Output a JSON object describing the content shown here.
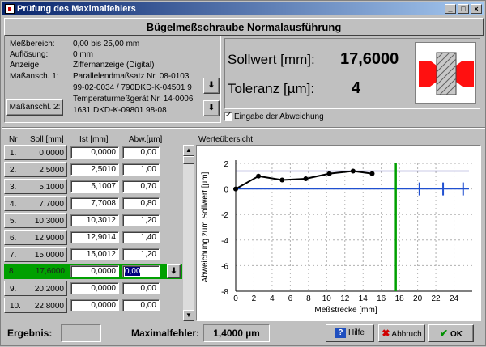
{
  "window": {
    "title": "Prüfung des Maximalfehlers",
    "minimize": "_",
    "maximize": "□",
    "close": "×"
  },
  "header": "Bügelmeßschraube Normalausführung",
  "info": {
    "messbereich_label": "Meßbereich:",
    "messbereich_value": "0,00 bis   25,00 mm",
    "aufloesung_label": "Auflösung:",
    "aufloesung_value": "0 mm",
    "anzeige_label": "Anzeige:",
    "anzeige_value": "Ziffernanzeige (Digital)",
    "massanschl1_label": "Maßansch. 1:",
    "massanschl1_line1": "Parallelendmaßsatz Nr. 08-0103",
    "massanschl1_line2": "99-02-0034 / 790DKD-K-04501 9",
    "massanschl2_button": "Maßanschl. 2:",
    "massanschl2_line1": "Temperaturmeßgerät Nr. 14-0006",
    "massanschl2_line2": "1631 DKD-K-09801 98-08"
  },
  "sollwert": {
    "label": "Sollwert [mm]:",
    "value": "17,6000",
    "toleranz_label": "Toleranz [µm]:",
    "toleranz_value": "4"
  },
  "eingabe_checkbox": "Eingabe der Abweichung",
  "table": {
    "headers": {
      "nr": "Nr",
      "soll": "Soll [mm]",
      "ist": "Ist [mm]",
      "abw": "Abw.[µm]"
    },
    "werteuebersicht": "Werteübersicht",
    "rows": [
      {
        "nr": "1.",
        "soll": "0,0000",
        "ist": "0,0000",
        "abw": "0,00"
      },
      {
        "nr": "2.",
        "soll": "2,5000",
        "ist": "2,5010",
        "abw": "1,00"
      },
      {
        "nr": "3.",
        "soll": "5,1000",
        "ist": "5,1007",
        "abw": "0,70"
      },
      {
        "nr": "4.",
        "soll": "7,7000",
        "ist": "7,7008",
        "abw": "0,80"
      },
      {
        "nr": "5.",
        "soll": "10,3000",
        "ist": "10,3012",
        "abw": "1,20"
      },
      {
        "nr": "6.",
        "soll": "12,9000",
        "ist": "12,9014",
        "abw": "1,40"
      },
      {
        "nr": "7.",
        "soll": "15,0000",
        "ist": "15,0012",
        "abw": "1,20"
      },
      {
        "nr": "8.",
        "soll": "17,6000",
        "ist": "0,0000",
        "abw": "0,00"
      },
      {
        "nr": "9.",
        "soll": "20,2000",
        "ist": "0,0000",
        "abw": "0,00"
      },
      {
        "nr": "10.",
        "soll": "22,8000",
        "ist": "0,0000",
        "abw": "0,00"
      }
    ],
    "active_row": 7
  },
  "chart_data": {
    "type": "line",
    "xlabel": "Meßstrecke [mm]",
    "ylabel": "Abweichung zum Sollwert [µm]",
    "xlim": [
      0,
      26
    ],
    "ylim": [
      -8,
      2
    ],
    "xticks": [
      0,
      2,
      4,
      6,
      8,
      10,
      12,
      14,
      16,
      18,
      20,
      22,
      24
    ],
    "yticks": [
      2,
      0,
      -2,
      -4,
      -6,
      -8
    ],
    "series": [
      {
        "x": [
          0,
          2.5,
          5.1,
          7.7,
          10.3,
          12.9,
          15.0
        ],
        "y": [
          0,
          1.0,
          0.7,
          0.8,
          1.2,
          1.4,
          1.2
        ]
      }
    ],
    "tolerance": 1.4,
    "current_x": 17.6,
    "upcoming_x": [
      20.2,
      22.8,
      25.0
    ],
    "grid": true
  },
  "footer": {
    "ergebnis_label": "Ergebnis:",
    "maxfehler_label": "Maximalfehler:",
    "maxfehler_value": "1,4000 µm",
    "hilfe": "Hilfe",
    "abbruch": "Abbruch",
    "ok": "OK"
  }
}
